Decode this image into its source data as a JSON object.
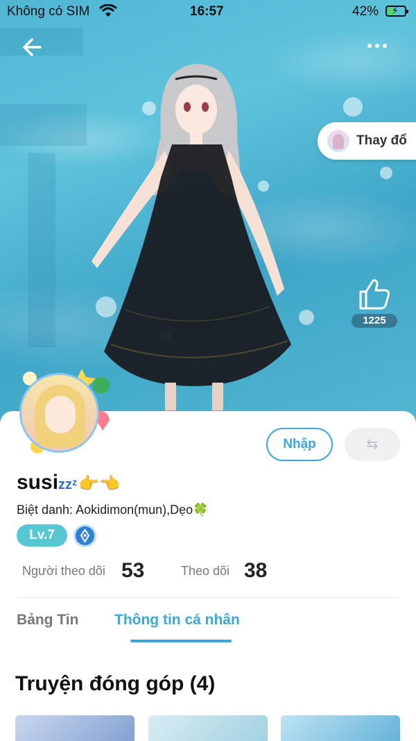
{
  "status_bar": {
    "carrier": "Không có SIM",
    "time": "16:57",
    "battery_percent": "42%",
    "battery_level": 0.42
  },
  "header": {
    "back_icon": "arrow-left-icon",
    "more_icon": "more-horizontal-icon"
  },
  "hero": {
    "change_outfit_label": "Thay đổ",
    "like_icon": "thumbs-up-icon",
    "like_count": "1225"
  },
  "profile": {
    "enter_button_label": "Nhập",
    "swap_icon": "swap-arrows-icon",
    "swap_glyph": "⇆",
    "username": "susi",
    "username_suffix": "zzᶻ",
    "username_emoji": "👉👈",
    "nickname": "Biệt danh: Aokidimon(mun),Dẹo🍀",
    "level": "Lv.7",
    "followers_label": "Người theo dõi",
    "followers_count": "53",
    "following_label": "Theo dõi",
    "following_count": "38"
  },
  "tabs": [
    {
      "label": "Bảng Tin",
      "active": false
    },
    {
      "label": "Thông tin cá nhân",
      "active": true
    }
  ],
  "section": {
    "title": "Truyện đóng góp (4)"
  },
  "colors": {
    "accent": "#3aa7e0",
    "level_badge": "#57c7d4",
    "hero_water": "#4fb6d4"
  }
}
